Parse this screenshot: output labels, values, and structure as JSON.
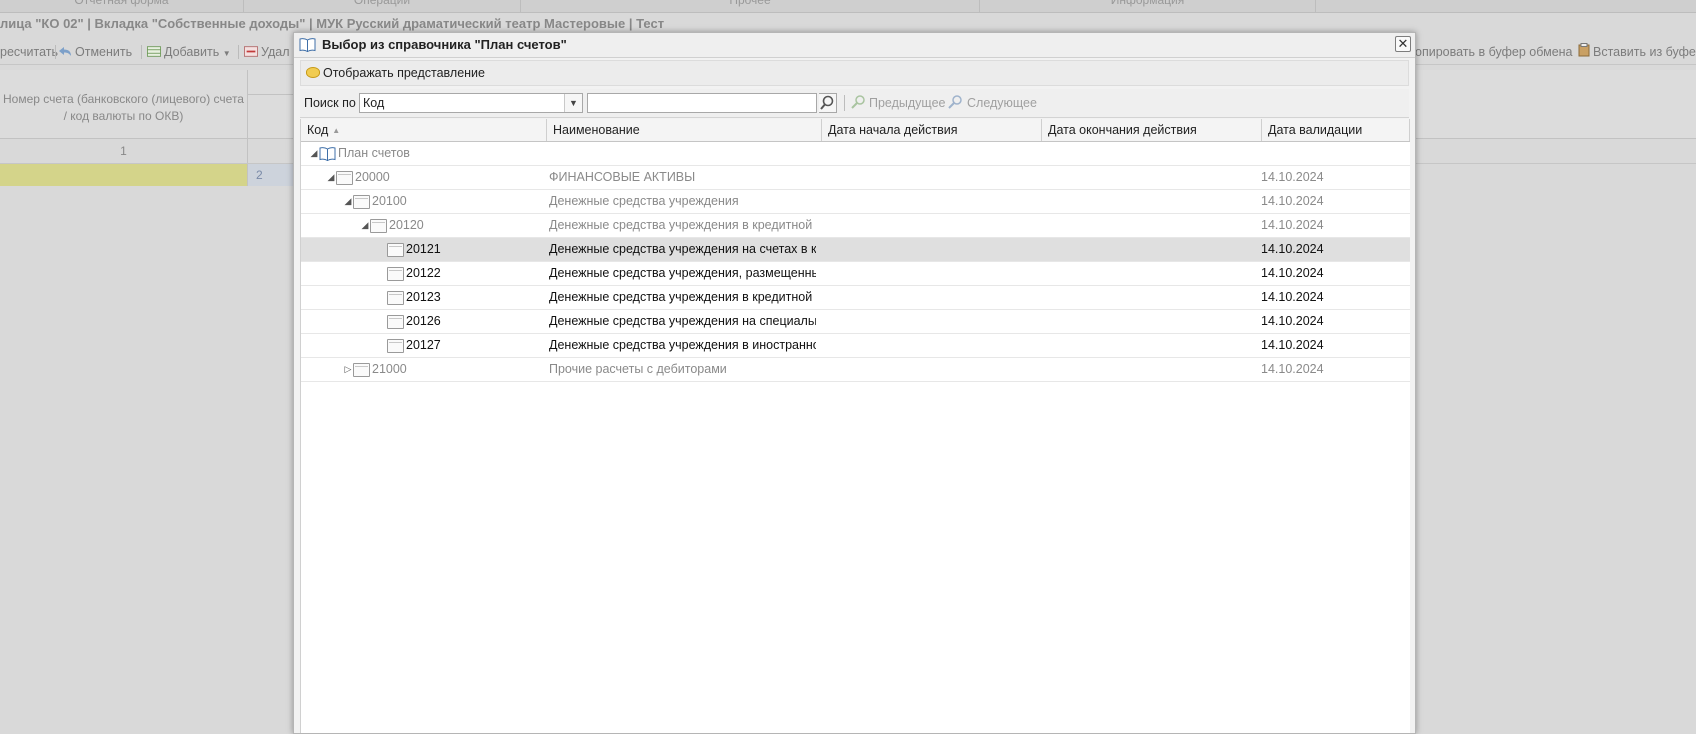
{
  "background": {
    "tabs": [
      "Отчетная форма",
      "Операции",
      "Прочее",
      "Информация"
    ],
    "title": "лица \"КО 02\" | Вкладка \"Собственные доходы\" | МУК Русский драматический театр Мастеровые | Тест",
    "toolbar": {
      "recalc": "ресчитать",
      "cancel": "Отменить",
      "add": "Добавить",
      "delete": "Удал",
      "copy": "опировать в буфер обмена",
      "paste": "Вставить из буфер"
    },
    "column_header": "Номер счета (банковского (лицевого) счета / код валюты по ОКВ)",
    "column_number": "1",
    "row_number": "2"
  },
  "modal": {
    "title": "Выбор из справочника \"План счетов\"",
    "close_label": "✕",
    "view_button": "Отображать представление",
    "search": {
      "label": "Поиск по",
      "field_value": "Код",
      "input_value": "",
      "prev_label": "Предыдущее",
      "next_label": "Следующее"
    },
    "columns": {
      "code": "Код",
      "name": "Наименование",
      "start": "Дата начала действия",
      "end": "Дата окончания действия",
      "valid": "Дата валидации"
    },
    "rows": [
      {
        "code": "План счетов",
        "name": "",
        "start": "",
        "end": "",
        "valid": "",
        "level": 0,
        "expander": "expanded",
        "icon": "book-icon",
        "style": "muted"
      },
      {
        "code": "20000",
        "name": "ФИНАНСОВЫЕ АКТИВЫ",
        "start": "",
        "end": "",
        "valid": "14.10.2024",
        "level": 1,
        "expander": "expanded",
        "icon": "folder-icon",
        "style": "muted"
      },
      {
        "code": "20100",
        "name": "Денежные средства учреждения",
        "start": "",
        "end": "",
        "valid": "14.10.2024",
        "level": 2,
        "expander": "expanded",
        "icon": "folder-icon",
        "style": "muted"
      },
      {
        "code": "20120",
        "name": "Денежные средства учреждения в кредитной ор",
        "start": "",
        "end": "",
        "valid": "14.10.2024",
        "level": 3,
        "expander": "expanded",
        "icon": "folder-icon",
        "style": "muted"
      },
      {
        "code": "20121",
        "name": "Денежные средства учреждения на счетах в кре",
        "start": "",
        "end": "",
        "valid": "14.10.2024",
        "level": 4,
        "expander": "none",
        "icon": "folder-icon",
        "style": "dark",
        "selected": true
      },
      {
        "code": "20122",
        "name": "Денежные средства учреждения, размещенные",
        "start": "",
        "end": "",
        "valid": "14.10.2024",
        "level": 4,
        "expander": "none",
        "icon": "folder-icon",
        "style": "dark"
      },
      {
        "code": "20123",
        "name": "Денежные средства учреждения в кредитной ор",
        "start": "",
        "end": "",
        "valid": "14.10.2024",
        "level": 4,
        "expander": "none",
        "icon": "folder-icon",
        "style": "dark"
      },
      {
        "code": "20126",
        "name": "Денежные средства учреждения на специальны",
        "start": "",
        "end": "",
        "valid": "14.10.2024",
        "level": 4,
        "expander": "none",
        "icon": "folder-icon",
        "style": "dark"
      },
      {
        "code": "20127",
        "name": "Денежные средства учреждения в иностранной",
        "start": "",
        "end": "",
        "valid": "14.10.2024",
        "level": 4,
        "expander": "none",
        "icon": "folder-icon",
        "style": "dark"
      },
      {
        "code": "21000",
        "name": "Прочие расчеты с дебиторами",
        "start": "",
        "end": "",
        "valid": "14.10.2024",
        "level": 2,
        "expander": "collapsed",
        "icon": "folder-icon",
        "style": "muted"
      }
    ]
  },
  "colors": {
    "highlight_row": "#d4d48a",
    "selected_row": "#dfdfdf",
    "muted_text": "#8a8a8a"
  }
}
